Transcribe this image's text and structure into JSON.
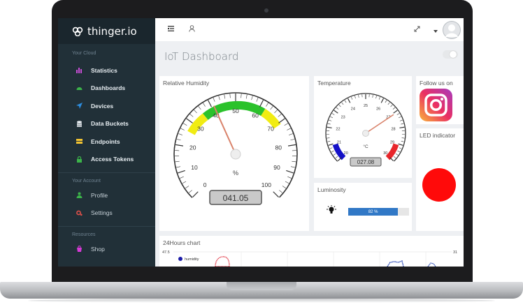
{
  "brand": {
    "name": "thinger.io"
  },
  "sidebar": {
    "sections": [
      {
        "title": "Your Cloud"
      },
      {
        "title": "Your Account"
      },
      {
        "title": "Resources"
      }
    ],
    "cloud_items": [
      {
        "label": "Statistics",
        "icon": "bar-chart-icon",
        "color": "#c94dd6"
      },
      {
        "label": "Dashboards",
        "icon": "dashboard-icon",
        "color": "#3cb44a"
      },
      {
        "label": "Devices",
        "icon": "rocket-icon",
        "color": "#2d8ee0"
      },
      {
        "label": "Data Buckets",
        "icon": "database-icon",
        "color": "#e9eef2"
      },
      {
        "label": "Endpoints",
        "icon": "endpoints-icon",
        "color": "#f1c232"
      },
      {
        "label": "Access Tokens",
        "icon": "lock-icon",
        "color": "#3cb44a"
      }
    ],
    "account_items": [
      {
        "label": "Profile",
        "icon": "user-icon",
        "color": "#3cb44a"
      },
      {
        "label": "Settings",
        "icon": "gears-icon",
        "color": "#e0504a"
      }
    ],
    "resource_items": [
      {
        "label": "Shop",
        "icon": "shop-icon",
        "color": "#d63ad6"
      }
    ]
  },
  "page": {
    "title": "IoT Dashboard"
  },
  "widgets": {
    "humidity": {
      "title": "Relative Humidity",
      "unit": "%",
      "value_text": "041.05",
      "value": 41.05,
      "min": 0,
      "max": 100,
      "ticks": [
        "0",
        "10",
        "20",
        "30",
        "40",
        "50",
        "60",
        "70",
        "80",
        "90",
        "100"
      ]
    },
    "temperature": {
      "title": "Temperature",
      "unit": "°C",
      "value_text": "027.08",
      "value": 27.08,
      "min": 20,
      "max": 30,
      "ticks": [
        "20",
        "21",
        "22",
        "23",
        "24",
        "25",
        "26",
        "27",
        "28",
        "29",
        "30"
      ]
    },
    "follow": {
      "title": "Follow us on"
    },
    "led": {
      "title": "LED indicator",
      "color": "#ff0a0a"
    },
    "luminosity": {
      "title": "Luminosity",
      "value_text": "82 %",
      "value": 82
    },
    "chart": {
      "title": "24Hours chart",
      "y_left_top": "47.5",
      "y_right_top": "31",
      "legend": "humidity"
    }
  }
}
